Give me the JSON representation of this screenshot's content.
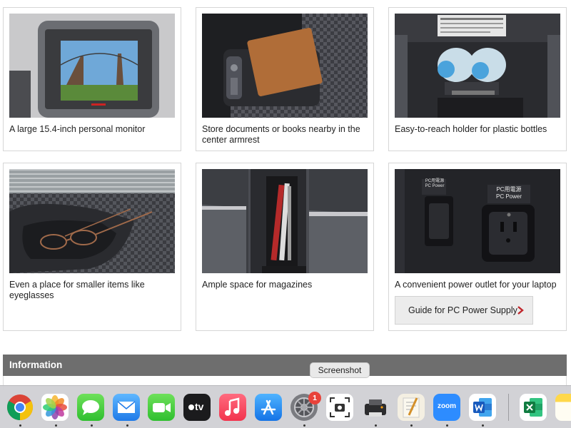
{
  "cards": [
    {
      "caption": "A large 15.4-inch personal monitor"
    },
    {
      "caption": "Store documents or books nearby in the center armrest"
    },
    {
      "caption": "Easy-to-reach holder for plastic bottles"
    },
    {
      "caption": "Even a place for smaller items like eyeglasses"
    },
    {
      "caption": "Ample space for magazines"
    },
    {
      "caption": "A convenient power outlet for your laptop"
    }
  ],
  "guide_button": {
    "label": "Guide for PC Power Supply"
  },
  "outlet_labels": {
    "jp": "PC用電源",
    "en": "PC Power"
  },
  "information": {
    "title": "Information"
  },
  "tooltip": {
    "text": "Screenshot"
  },
  "dock": {
    "apps": [
      "chrome-icon",
      "photos-icon",
      "messages-icon",
      "mail-icon",
      "facetime-icon",
      "apple-tv-icon",
      "music-icon",
      "app-store-icon",
      "system-preferences-icon",
      "screenshot-icon",
      "printer-icon",
      "script-editor-icon",
      "zoom-icon",
      "word-icon",
      "excel-icon",
      "notes-icon"
    ],
    "tv_label": "tv",
    "zoom_label": "zoom",
    "settings_badge": "1"
  }
}
